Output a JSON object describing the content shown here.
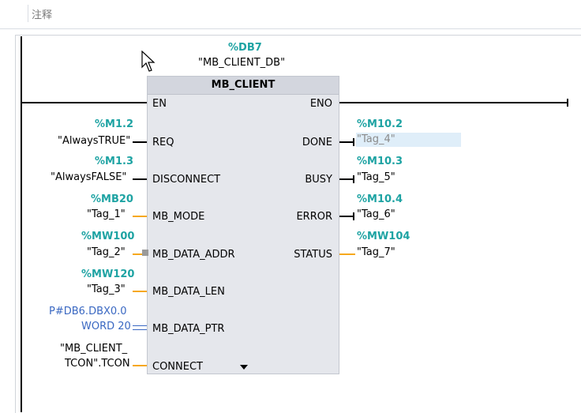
{
  "comment": {
    "text": "注释"
  },
  "block": {
    "instance_address": "%DB7",
    "instance_name": "\"MB_CLIENT_DB\"",
    "title": "MB_CLIENT",
    "en": "EN",
    "eno": "ENO",
    "more_icon": "triangle-down-icon"
  },
  "inputs": {
    "req": {
      "address": "%M1.2",
      "tag": "\"AlwaysTRUE\"",
      "pin": "REQ"
    },
    "disconnect": {
      "address": "%M1.3",
      "tag": "\"AlwaysFALSE\"",
      "pin": "DISCONNECT"
    },
    "mb_mode": {
      "address": "%MB20",
      "tag": "\"Tag_1\"",
      "pin": "MB_MODE"
    },
    "mb_data_addr": {
      "address": "%MW100",
      "tag": "\"Tag_2\"",
      "pin": "MB_DATA_ADDR"
    },
    "mb_data_len": {
      "address": "%MW120",
      "tag": "\"Tag_3\"",
      "pin": "MB_DATA_LEN"
    },
    "mb_data_ptr": {
      "address": "P#DB6.DBX0.0",
      "tag": "WORD 20",
      "pin": "MB_DATA_PTR"
    },
    "connect": {
      "tag_line1": "\"MB_CLIENT_",
      "tag_line2": "TCON\".TCON",
      "pin": "CONNECT"
    }
  },
  "outputs": {
    "done": {
      "address": "%M10.2",
      "tag": "\"Tag_4\"",
      "pin": "DONE"
    },
    "busy": {
      "address": "%M10.3",
      "tag": "\"Tag_5\"",
      "pin": "BUSY"
    },
    "error": {
      "address": "%M10.4",
      "tag": "\"Tag_6\"",
      "pin": "ERROR"
    },
    "status": {
      "address": "%MW104",
      "tag": "\"Tag_7\"",
      "pin": "STATUS"
    }
  },
  "colors": {
    "address": "#1ea3a3",
    "pointer": "#3a68c2",
    "orange_wire": "#f6a81c",
    "block_fill": "#e5e7ec",
    "selection": "#dfeef9"
  }
}
